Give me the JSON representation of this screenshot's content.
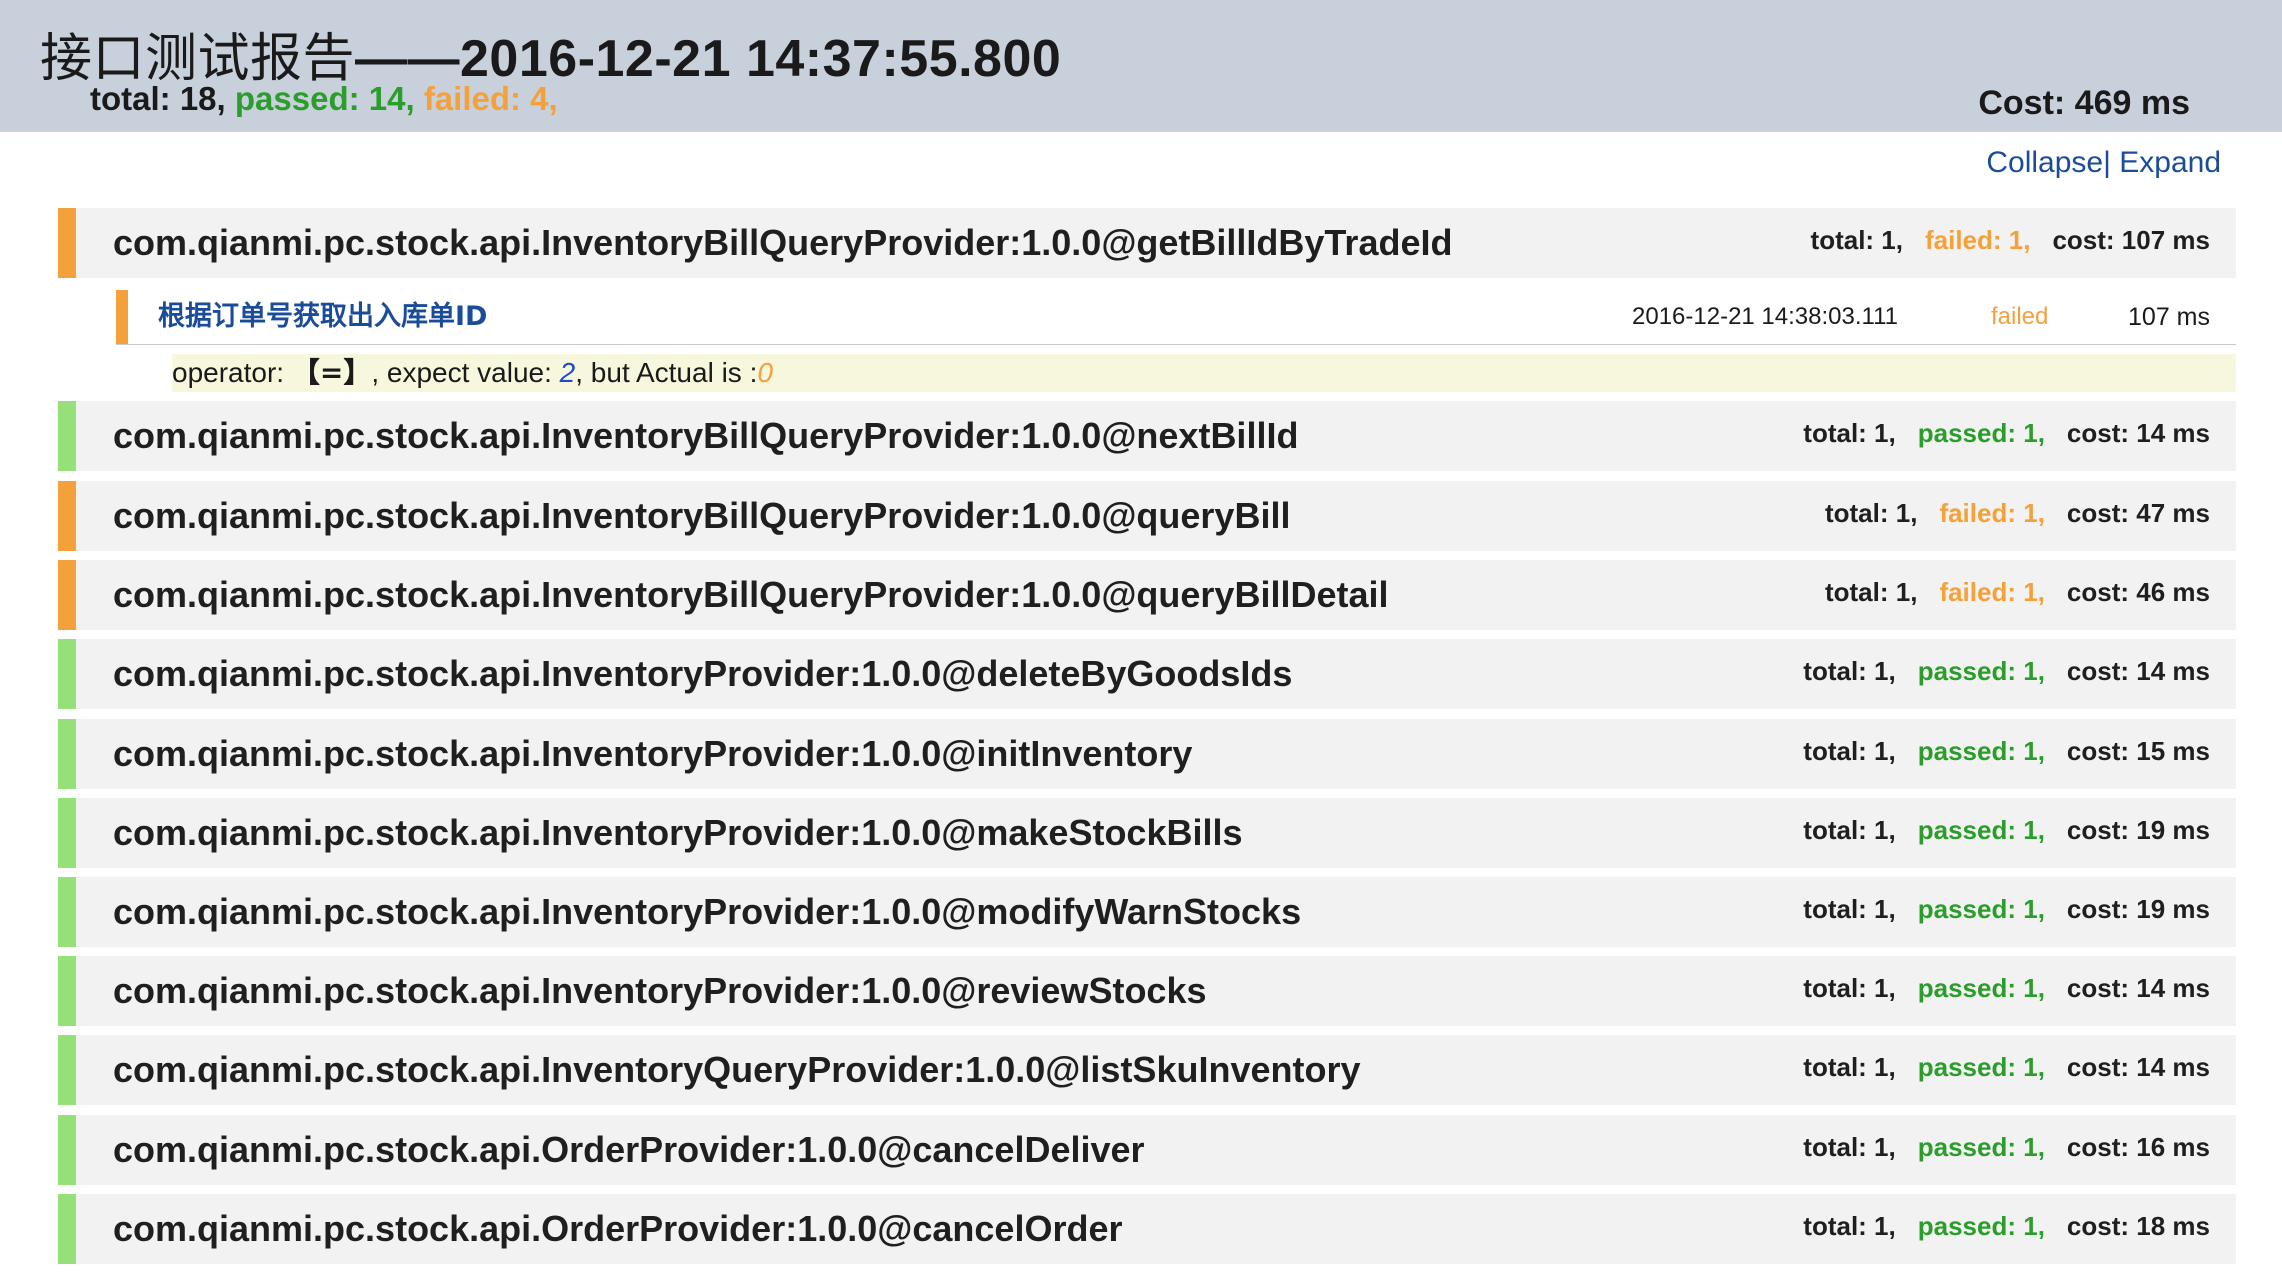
{
  "header": {
    "title_zh": "接口测试报告",
    "title_rest": "——2016-12-21 14:37:55.800",
    "total": "total: 18,",
    "passed": "passed: 14,",
    "failed": "failed: 4,",
    "cost": "Cost: 469 ms"
  },
  "toggles": {
    "collapse": "Collapse",
    "separator": "|",
    "expand": "Expand"
  },
  "colors": {
    "failed": "#f5a13b",
    "passed": "#96e07a",
    "passed_text": "#2a9d2a",
    "link": "#1b4c9a"
  },
  "suites": [
    {
      "name": "com.qianmi.pc.stock.api.InventoryBillQueryProvider:1.0.0@getBillIdByTradeId",
      "total": "total: 1,",
      "result": "failed: 1,",
      "status": "failed",
      "cost": "cost: 107 ms"
    },
    {
      "name": "com.qianmi.pc.stock.api.InventoryBillQueryProvider:1.0.0@nextBillId",
      "total": "total: 1,",
      "result": "passed: 1,",
      "status": "passed",
      "cost": "cost: 14 ms"
    },
    {
      "name": "com.qianmi.pc.stock.api.InventoryBillQueryProvider:1.0.0@queryBill",
      "total": "total: 1,",
      "result": "failed: 1,",
      "status": "failed",
      "cost": "cost: 47 ms"
    },
    {
      "name": "com.qianmi.pc.stock.api.InventoryBillQueryProvider:1.0.0@queryBillDetail",
      "total": "total: 1,",
      "result": "failed: 1,",
      "status": "failed",
      "cost": "cost: 46 ms"
    },
    {
      "name": "com.qianmi.pc.stock.api.InventoryProvider:1.0.0@deleteByGoodsIds",
      "total": "total: 1,",
      "result": "passed: 1,",
      "status": "passed",
      "cost": "cost: 14 ms"
    },
    {
      "name": "com.qianmi.pc.stock.api.InventoryProvider:1.0.0@initInventory",
      "total": "total: 1,",
      "result": "passed: 1,",
      "status": "passed",
      "cost": "cost: 15 ms"
    },
    {
      "name": "com.qianmi.pc.stock.api.InventoryProvider:1.0.0@makeStockBills",
      "total": "total: 1,",
      "result": "passed: 1,",
      "status": "passed",
      "cost": "cost: 19 ms"
    },
    {
      "name": "com.qianmi.pc.stock.api.InventoryProvider:1.0.0@modifyWarnStocks",
      "total": "total: 1,",
      "result": "passed: 1,",
      "status": "passed",
      "cost": "cost: 19 ms"
    },
    {
      "name": "com.qianmi.pc.stock.api.InventoryProvider:1.0.0@reviewStocks",
      "total": "total: 1,",
      "result": "passed: 1,",
      "status": "passed",
      "cost": "cost: 14 ms"
    },
    {
      "name": "com.qianmi.pc.stock.api.InventoryQueryProvider:1.0.0@listSkuInventory",
      "total": "total: 1,",
      "result": "passed: 1,",
      "status": "passed",
      "cost": "cost: 14 ms"
    },
    {
      "name": "com.qianmi.pc.stock.api.OrderProvider:1.0.0@cancelDeliver",
      "total": "total: 1,",
      "result": "passed: 1,",
      "status": "passed",
      "cost": "cost: 16 ms"
    },
    {
      "name": "com.qianmi.pc.stock.api.OrderProvider:1.0.0@cancelOrder",
      "total": "total: 1,",
      "result": "passed: 1,",
      "status": "passed",
      "cost": "cost: 18 ms"
    }
  ],
  "expanded_case": {
    "name": "根据订单号获取出入库单ID",
    "time": "2016-12-21 14:38:03.111",
    "status": "failed",
    "cost": "107 ms",
    "detail": {
      "prefix": "operator: ",
      "operator": "【=】",
      "mid": ", expect value: ",
      "expected": "2",
      "mid2": ", but Actual is :",
      "actual": "0"
    }
  }
}
